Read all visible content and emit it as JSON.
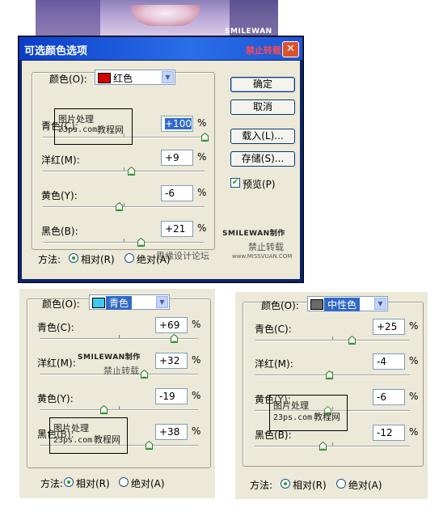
{
  "watermark": {
    "brand": "SMILEWAN制作",
    "ban": "禁止转载",
    "stamp_line1": "图片处理",
    "stamp_site": "23ps.com",
    "stamp_line2": "教程网",
    "forum": "思缘设计论坛",
    "forum_url": "www.MISSVUAN.COM"
  },
  "dialog": {
    "title": "可选颜色选项",
    "title_watermark": "禁止转载",
    "close": "✕",
    "color_label": "颜色(O):",
    "color_value": "红色",
    "color_swatch": "#d40000",
    "sliders": [
      {
        "label": "青色(C):",
        "value": "+100",
        "pos": 100
      },
      {
        "label": "洋红(M):",
        "value": "+9",
        "pos": 54.5
      },
      {
        "label": "黄色(Y):",
        "value": "-6",
        "pos": 47
      },
      {
        "label": "黑色(B):",
        "value": "+21",
        "pos": 60.5
      }
    ],
    "pct": "%",
    "buttons": {
      "ok": "确定",
      "cancel": "取消",
      "load": "载入(L)...",
      "save": "存储(S)..."
    },
    "preview_label": "预览(P)",
    "preview_checked": true,
    "method_label": "方法:",
    "relative": "相对(R)",
    "absolute": "绝对(A)"
  },
  "panel_cyan": {
    "color_label": "颜色(O):",
    "color_value": "青色",
    "color_swatch": "#3cc8f0",
    "sliders": [
      {
        "label": "青色(C):",
        "value": "+69",
        "pos": 84.5
      },
      {
        "label": "洋红(M):",
        "value": "+32",
        "pos": 66
      },
      {
        "label": "黄色(Y):",
        "value": "-19",
        "pos": 40.5
      },
      {
        "label": "黑色(B):",
        "value": "+38",
        "pos": 69
      }
    ],
    "pct": "%",
    "method_label": "方法:",
    "relative": "相对(R)",
    "absolute": "绝对(A)"
  },
  "panel_neutral": {
    "color_label": "颜色(O):",
    "color_value": "中性色",
    "color_swatch": "#6a6a6a",
    "sliders": [
      {
        "label": "青色(C):",
        "value": "+25",
        "pos": 62.5
      },
      {
        "label": "洋红(M):",
        "value": "-4",
        "pos": 48
      },
      {
        "label": "黄色(Y):",
        "value": "-6",
        "pos": 47
      },
      {
        "label": "黑色(B):",
        "value": "-12",
        "pos": 44
      }
    ],
    "pct": "%",
    "method_label": "方法:",
    "relative": "相对(R)",
    "absolute": "绝对(A)"
  }
}
